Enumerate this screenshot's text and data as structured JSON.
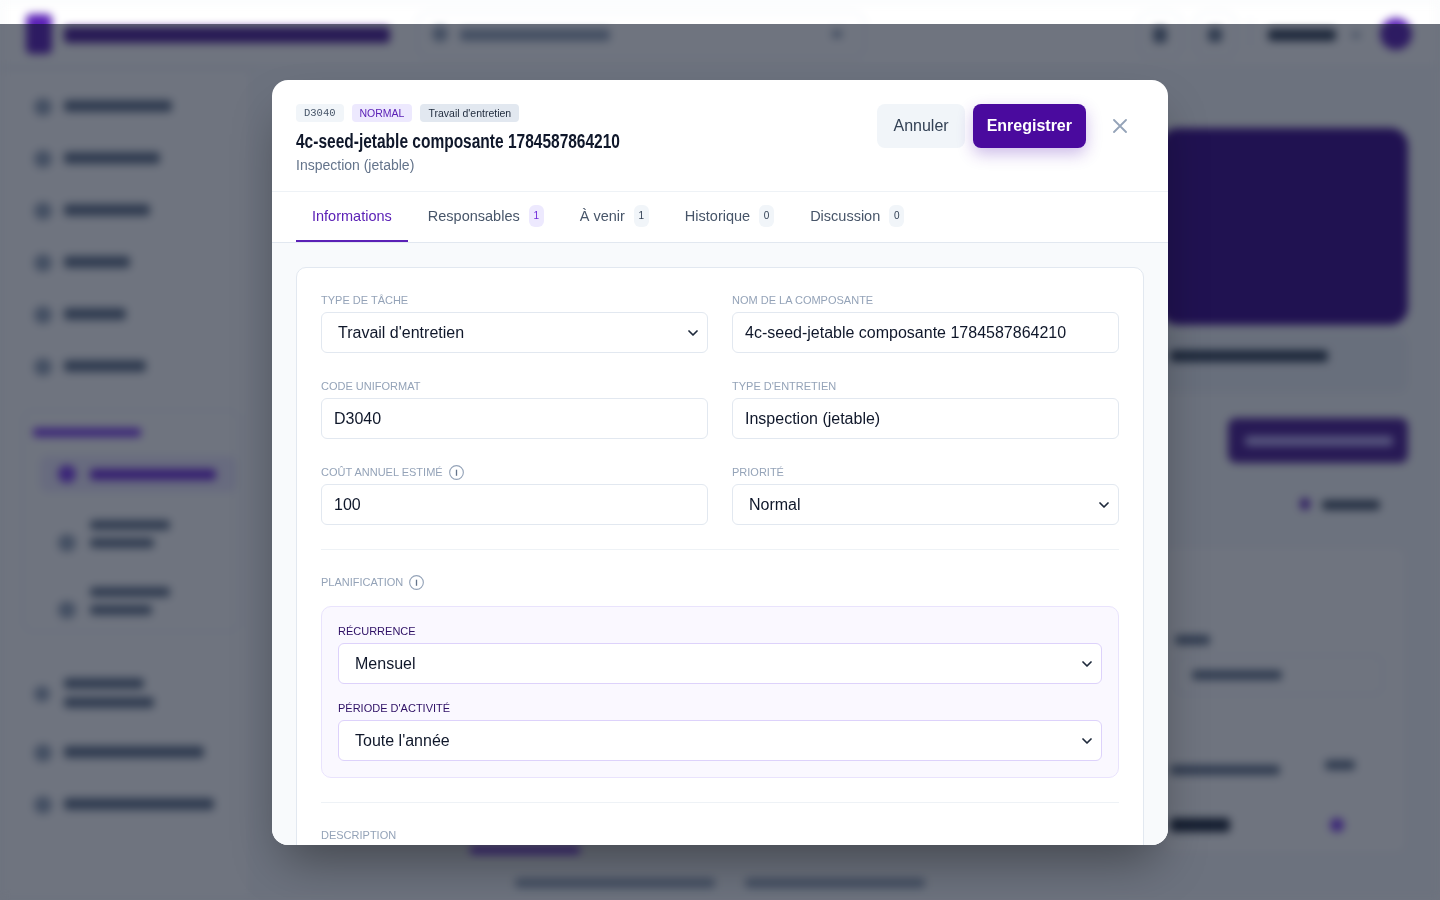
{
  "modal": {
    "badges": [
      {
        "text": "D3040",
        "kind": "code"
      },
      {
        "text": "NORMAL",
        "kind": "priority"
      },
      {
        "text": "Travail d'entretien",
        "kind": "category"
      }
    ],
    "title": "4c-seed-jetable composante 1784587864210",
    "subtitle": "Inspection (jetable)",
    "actions": [
      {
        "label": "Annuler",
        "kind": "secondary"
      },
      {
        "label": "Enregistrer",
        "kind": "primary"
      }
    ],
    "tabs": [
      {
        "label": "Informations",
        "selected": true
      },
      {
        "label": "Responsables",
        "count": {
          "text": "1",
          "highlighted": true
        },
        "selected": false
      },
      {
        "label": "À venir",
        "count": {
          "text": "1",
          "highlighted": false
        },
        "selected": false
      },
      {
        "label": "Historique",
        "count": {
          "text": "0",
          "highlighted": false
        },
        "selected": false
      },
      {
        "label": "Discussion",
        "count": {
          "text": "0",
          "highlighted": false
        },
        "selected": false
      }
    ],
    "sections": [
      {
        "kind": "grid",
        "fields": [
          {
            "label": "TYPE DE TÂCHE",
            "kind": "select",
            "value": "Travail d'entretien",
            "info": false
          },
          {
            "label": "NOM DE LA COMPOSANTE",
            "kind": "input",
            "value": "4c-seed-jetable composante 1784587864210",
            "info": false
          },
          {
            "label": "CODE UNIFORMAT",
            "kind": "input",
            "value": "D3040",
            "info": false
          },
          {
            "label": "TYPE D'ENTRETIEN",
            "kind": "input",
            "value": "Inspection (jetable)",
            "info": false
          },
          {
            "label": "COÛT ANNUEL ESTIMÉ",
            "kind": "input",
            "value": "100",
            "info": true
          },
          {
            "label": "PRIORITÉ",
            "kind": "select",
            "value": "Normal",
            "info": false
          }
        ]
      },
      {
        "kind": "panel",
        "title": "PLANIFICATION",
        "info": true,
        "fields": [
          {
            "label": "RÉCURRENCE",
            "kind": "select",
            "value": "Mensuel",
            "info": false
          },
          {
            "label": "PÉRIODE D'ACTIVITÉ",
            "kind": "select",
            "value": "Toute l'année",
            "info": false
          }
        ]
      },
      {
        "kind": "heading",
        "title": "DESCRIPTION",
        "info": false
      }
    ]
  }
}
